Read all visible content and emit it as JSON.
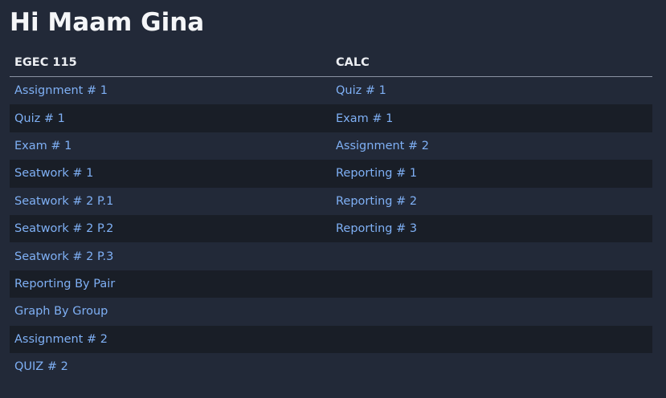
{
  "greeting": "Hi Maam Gina",
  "columns": [
    {
      "header": "EGEC 115",
      "items": [
        "Assignment # 1",
        "Quiz # 1",
        "Exam # 1",
        "Seatwork # 1",
        "Seatwork # 2 P.1",
        "Seatwork # 2 P.2",
        "Seatwork # 2 P.3",
        "Reporting By Pair",
        "Graph By Group",
        "Assignment # 2",
        "QUIZ # 2"
      ]
    },
    {
      "header": "CALC",
      "items": [
        "Quiz # 1",
        "Exam # 1",
        "Assignment # 2",
        "Reporting # 1",
        "Reporting # 2",
        "Reporting # 3"
      ]
    }
  ],
  "colors": {
    "background": "#222938",
    "stripe": "#191e27",
    "link": "#7fb0f5",
    "heading": "#f5f6f8"
  }
}
